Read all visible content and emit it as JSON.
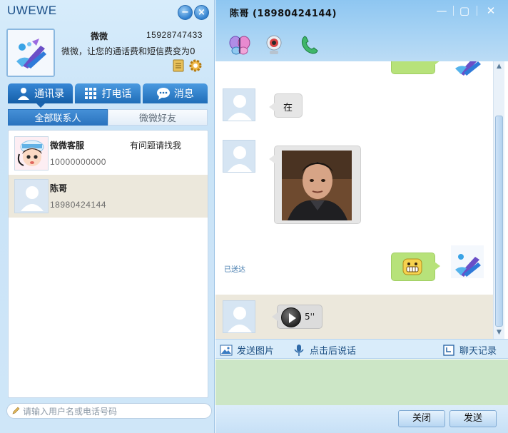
{
  "app": {
    "brand": "UWEWE",
    "window_buttons": {
      "minimize": "−",
      "close": "×"
    }
  },
  "profile": {
    "name": "微微",
    "phone": "15928747433",
    "message": "微微，让您的通话费和短信费变为0"
  },
  "main_tabs": [
    {
      "label": "通讯录",
      "icon": "contacts-icon",
      "active": true
    },
    {
      "label": "打电话",
      "icon": "dialpad-icon",
      "active": false
    },
    {
      "label": "消息",
      "icon": "message-icon",
      "active": false
    }
  ],
  "sub_tabs": [
    {
      "label": "全部联系人",
      "active": true
    },
    {
      "label": "微微好友",
      "active": false
    }
  ],
  "contacts": [
    {
      "name": "微微客服",
      "number": "10000000000",
      "status": "有问题请找我",
      "avatar": "support-cartoon-avatar",
      "selected": false
    },
    {
      "name": "陈哥",
      "number": "18980424144",
      "status": "",
      "avatar": "default-user-avatar",
      "selected": true
    }
  ],
  "search": {
    "placeholder": "请输入用户名或电话号码"
  },
  "chat": {
    "title": "陈哥 (18980424144)",
    "window_controls": {
      "minimize": "—",
      "maximize": "▢",
      "close": "✕"
    },
    "toolbar_icons": [
      "butterfly-emoticon-icon",
      "webcam-icon",
      "phone-handset-icon"
    ],
    "messages": [
      {
        "side": "right",
        "type": "text",
        "text": "",
        "partial": true
      },
      {
        "side": "left",
        "type": "text",
        "text": "在"
      },
      {
        "side": "left",
        "type": "image",
        "description": "photo"
      },
      {
        "side": "right",
        "type": "emoticon",
        "icon": "grin-emoticon-icon"
      },
      {
        "side": "left",
        "type": "voice",
        "duration": "5''"
      }
    ],
    "delivered_label": "已送达",
    "actions": {
      "send_image": "发送图片",
      "voice": "点击后说话",
      "history": "聊天记录"
    },
    "buttons": {
      "close": "关闭",
      "send": "发送"
    }
  },
  "colors": {
    "accent_blue": "#1f6db8",
    "titlebar_blue": "#8ec6f1",
    "bubble_green": "#b7e27a",
    "compose_green": "#cce6c6",
    "selected_row": "#ece8dc"
  }
}
